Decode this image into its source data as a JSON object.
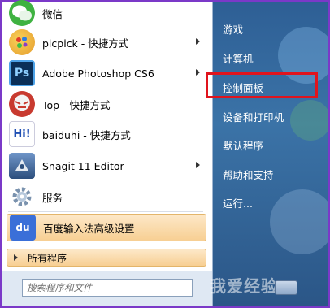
{
  "programs": [
    {
      "label": "微信",
      "icon": "wechat-icon",
      "color": "#3fb241",
      "has_arrow": false
    },
    {
      "label": "picpick - 快捷方式",
      "icon": "picpick-icon",
      "color": "#e69b2c",
      "has_arrow": true
    },
    {
      "label": "Adobe Photoshop CS6",
      "icon": "photoshop-icon",
      "glyph": "Ps",
      "color": "#0b2f57",
      "has_arrow": true
    },
    {
      "label": "Top - 快捷方式",
      "icon": "top-icon",
      "color": "#c83a2f",
      "has_arrow": false
    },
    {
      "label": "baiduhi - 快捷方式",
      "icon": "baiduhi-icon",
      "glyph": "Hi!",
      "color": "#ffffff",
      "has_arrow": false
    },
    {
      "label": "Snagit 11 Editor",
      "icon": "snagit-icon",
      "color": "#2d4f7d",
      "has_arrow": true
    },
    {
      "label": "服务",
      "icon": "gear-icon",
      "color": "#8aa6c5",
      "has_arrow": false
    },
    {
      "label": "百度输入法高级设置",
      "icon": "baidu-ime-icon",
      "glyph": "du",
      "color": "#3a6fd8",
      "has_arrow": false
    }
  ],
  "all_programs": "所有程序",
  "search_placeholder": "搜索程序和文件",
  "right_items": [
    "游戏",
    "计算机",
    "控制面板",
    "设备和打印机",
    "默认程序",
    "帮助和支持",
    "运行..."
  ],
  "highlighted_right_item": "控制面板",
  "watermark": "我爱经验",
  "colors": {
    "highlight_box": "#e0141d",
    "frame": "#7b39c8"
  }
}
